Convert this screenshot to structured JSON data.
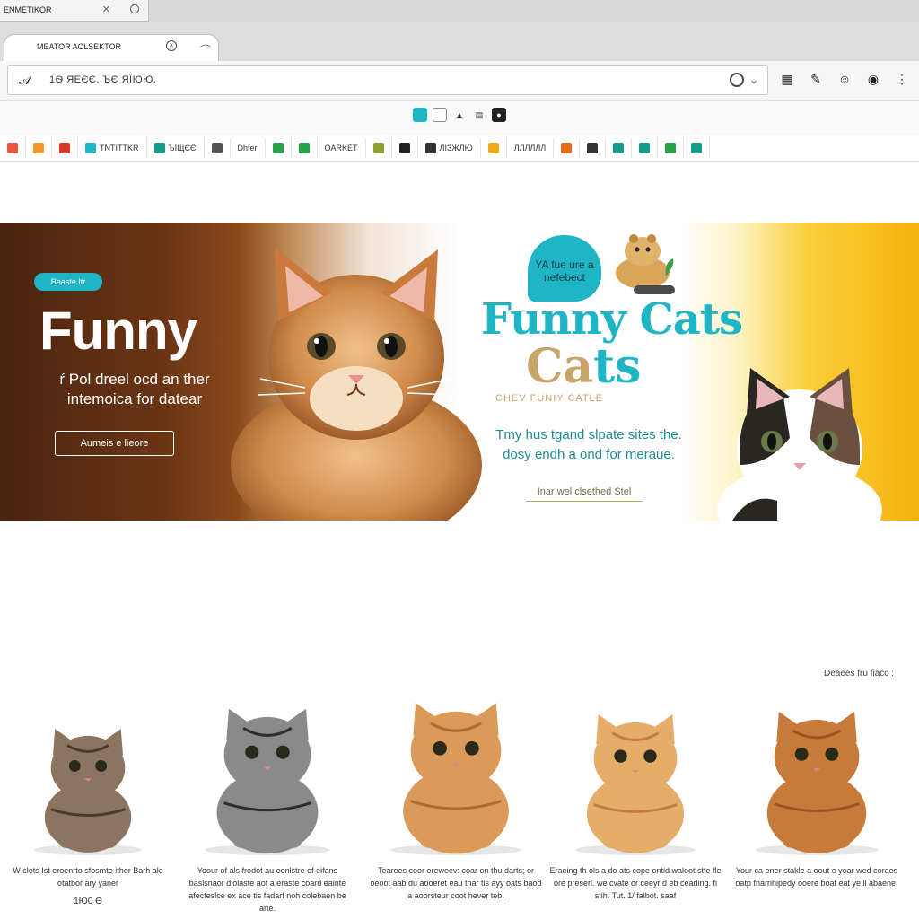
{
  "browser": {
    "window_title": "ENMETIKOR",
    "tab_title": "MEATOR ACLSEKTOR",
    "url": "1Ѳ ЯЕЄЄ.    ЪЄ ЯЇЮЮ.",
    "bookmarks": [
      {
        "label": "",
        "color": "#e9563b"
      },
      {
        "label": "",
        "color": "#f09a2b"
      },
      {
        "label": "",
        "color": "#d23a2a"
      },
      {
        "label": "TNTITTKR",
        "color": "#1fb5c4"
      },
      {
        "label": "ЪЇЩЄЄ",
        "color": "#1a9a8a"
      },
      {
        "label": "",
        "color": "#555555"
      },
      {
        "label": "Dhfer",
        "color": ""
      },
      {
        "label": "",
        "color": "#2aa148"
      },
      {
        "label": "",
        "color": "#2aa148"
      },
      {
        "label": "OARKET",
        "color": ""
      },
      {
        "label": "",
        "color": "#8aa030"
      },
      {
        "label": "",
        "color": "#222222"
      },
      {
        "label": "ЛІЗЖЛЮ",
        "color": "#333333"
      },
      {
        "label": "",
        "color": "#f0a81e"
      },
      {
        "label": "ЛЛЛЛЛЛ",
        "color": ""
      },
      {
        "label": "",
        "color": "#e46b1c"
      },
      {
        "label": "",
        "color": "#333333"
      },
      {
        "label": "",
        "color": "#1a9a8a"
      },
      {
        "label": "",
        "color": "#1a9a8a"
      },
      {
        "label": "",
        "color": "#2aa148"
      },
      {
        "label": "",
        "color": "#1a9a8a"
      }
    ]
  },
  "hero": {
    "badge_pill": "Beaste Itr",
    "title": "Funny",
    "subtitle": "ŕ Pol dreel ocd an ther intemoica for datear",
    "cta": "Aumeis e lieore",
    "bubble_text": "YA fue ure a nefebect",
    "brand_line1": "Funny Cats",
    "brand_line2_a": "Ca",
    "brand_line2_b": "ts",
    "brand_tagline": "CHEV FUNIY CATLE",
    "copy": "Tmy hus tgand slpate sites the. dosy endh a ond for meraue.",
    "link": "Inar wel clsethed Stel"
  },
  "products": {
    "sort_label": "Deaees fru fiacc :",
    "items": [
      {
        "desc": "W clets Ist eroenrto sfosmte ithor Barh ale otatbor ary yaner",
        "price": "1Ю0 Ѳ",
        "fur": "#8b7560",
        "stripe": "#4a3a2a"
      },
      {
        "desc": "Yoour of als frodot au eonlstre of eifans baslsnaor diolaste aot a eraste coard eainte afecteslce ex ace tis fadarf noh colebaen be arte.",
        "price": "",
        "fur": "#8a8a8a",
        "stripe": "#2e2e2e"
      },
      {
        "desc": "Tearees coor ereweev: coar on thu darts; or oeoot aab du aooeret eau thar tis ayy oats baod a aoorsteur coot hever teb.",
        "price": "",
        "fur": "#d99a5a",
        "stripe": "#b06a30"
      },
      {
        "desc": "Eraeing th ols a do ats cope ontid waloot stte fle ore preserl. we cvate or ceeyr d eb ceading. fi stih. Tut. 1/ falbot. saaf",
        "price": "",
        "fur": "#e6ac6a",
        "stripe": "#c27e3e"
      },
      {
        "desc": "Your ca ener stakle a oout e yoar wed coraes oatp fnarrihipedy ooere boat eat ye.ll abaene.",
        "price": "",
        "fur": "#c87a3a",
        "stripe": "#9a5424"
      }
    ]
  }
}
